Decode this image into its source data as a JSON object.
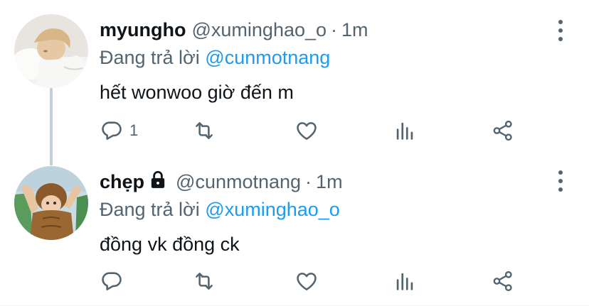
{
  "replying_prefix": "Đang trả lời",
  "tweets": [
    {
      "display_name": "myungho",
      "handle": "@xuminghao_o",
      "separator": "·",
      "time": "1m",
      "replying_to": "@cunmotnang",
      "text": "hết wonwoo giờ đến m",
      "reply_count": "1",
      "locked": false
    },
    {
      "display_name": "chẹp",
      "handle": "@cunmotnang",
      "separator": "·",
      "time": "1m",
      "replying_to": "@xuminghao_o",
      "text": "đồng vk đồng ck",
      "reply_count": "",
      "locked": true
    }
  ],
  "icons": {
    "reply": "reply-icon",
    "retweet": "retweet-icon",
    "like": "heart-icon",
    "analytics": "analytics-icon",
    "share": "share-icon",
    "more": "more-vertical-icon",
    "lock": "lock-icon"
  },
  "colors": {
    "text": "#0f1419",
    "secondary": "#536471",
    "link": "#1d9bf0",
    "thread_line": "#c4cfd6"
  }
}
